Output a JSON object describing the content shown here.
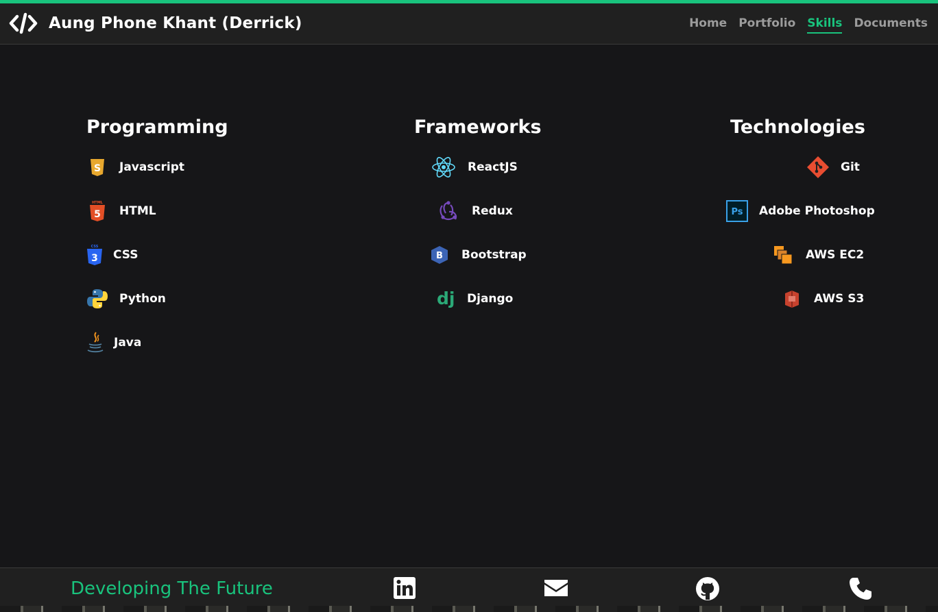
{
  "header": {
    "title": "Aung Phone Khant (Derrick)",
    "nav": [
      {
        "label": "Home"
      },
      {
        "label": "Portfolio"
      },
      {
        "label": "Skills",
        "active": true
      },
      {
        "label": "Documents"
      }
    ]
  },
  "sections": [
    {
      "title": "Programming",
      "items": [
        {
          "label": "Javascript",
          "icon": "js-icon"
        },
        {
          "label": "HTML",
          "icon": "html5-icon"
        },
        {
          "label": "CSS",
          "icon": "css3-icon"
        },
        {
          "label": "Python",
          "icon": "python-icon"
        },
        {
          "label": "Java",
          "icon": "java-icon"
        }
      ]
    },
    {
      "title": "Frameworks",
      "items": [
        {
          "label": "ReactJS",
          "icon": "react-icon"
        },
        {
          "label": "Redux",
          "icon": "redux-icon"
        },
        {
          "label": "Bootstrap",
          "icon": "bootstrap-icon"
        },
        {
          "label": "Django",
          "icon": "django-icon"
        }
      ]
    },
    {
      "title": "Technologies",
      "items": [
        {
          "label": "Git",
          "icon": "git-icon"
        },
        {
          "label": "Adobe Photoshop",
          "icon": "photoshop-icon"
        },
        {
          "label": "AWS EC2",
          "icon": "aws-ec2-icon"
        },
        {
          "label": "AWS S3",
          "icon": "aws-s3-icon"
        }
      ]
    }
  ],
  "footer": {
    "tagline": "Developing The Future",
    "social": [
      "linkedin-icon",
      "mail-icon",
      "github-icon",
      "phone-icon"
    ]
  },
  "colors": {
    "accent": "#19c37d",
    "background": "#161618",
    "navbar": "#202020",
    "nav_inactive": "#9c9c9c"
  }
}
